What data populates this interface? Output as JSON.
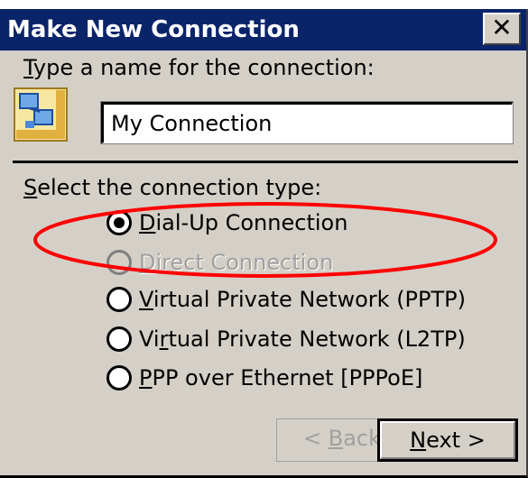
{
  "window": {
    "title": "Make New Connection",
    "close_glyph": "✕"
  },
  "name_section": {
    "prompt_accel": "T",
    "prompt_rest": "ype a name for the connection:",
    "icon": "network-connection-icon",
    "value": "My Connection"
  },
  "type_section": {
    "prompt_accel": "S",
    "prompt_rest": "elect the connection type:",
    "options": [
      {
        "pre": "",
        "accel": "D",
        "post": "ial-Up Connection",
        "checked": true,
        "disabled": false
      },
      {
        "pre": "",
        "accel": "D",
        "post": "irect Connection",
        "checked": false,
        "disabled": true
      },
      {
        "pre": "",
        "accel": "V",
        "post": "irtual Private Network (PPTP)",
        "checked": false,
        "disabled": false
      },
      {
        "pre": "Vi",
        "accel": "r",
        "post": "tual Private Network (L2TP)",
        "checked": false,
        "disabled": false
      },
      {
        "pre": "",
        "accel": "P",
        "post": "PP over Ethernet [PPPoE]",
        "checked": false,
        "disabled": false
      }
    ]
  },
  "buttons": {
    "back_pre": "< ",
    "back_accel": "B",
    "back_post": "ack",
    "next_accel": "N",
    "next_post": "ext >"
  },
  "colors": {
    "titlebar": "#0a246a",
    "face": "#d4d0c8",
    "annotation": "#ff0000"
  }
}
